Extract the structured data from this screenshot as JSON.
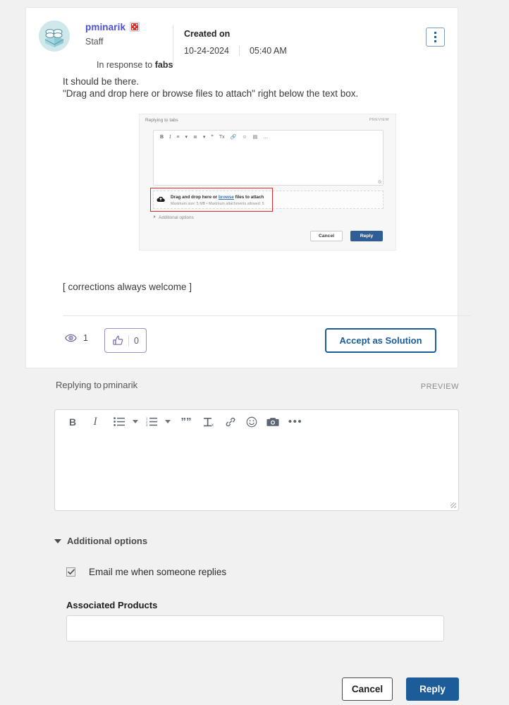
{
  "post": {
    "author": {
      "name": "pminarik",
      "role": "Staff",
      "badge_icon": "rank-badge-icon",
      "avatar_icon": "user-avatar"
    },
    "in_response_prefix": "In response to ",
    "in_response_to": "fabs",
    "meta": {
      "created_label": "Created on",
      "date": "10-24-2024",
      "time": "05:40 AM"
    },
    "menu_icon": "kebab-menu-icon",
    "body_line_1": "It should be there.",
    "body_line_2": "\"Drag and drop here or browse files to attach\" right below the text box.",
    "signature": "[ corrections always welcome ]",
    "embedded_image": {
      "title_prefix": "Replying to ",
      "title_target": "tabs",
      "preview_label": "PREVIEW",
      "toolbar": [
        "B",
        "I",
        "☰",
        "▾",
        "≡",
        "▾",
        "”",
        "Tx",
        "🔗",
        "☺",
        "📷",
        "…"
      ],
      "drop_text_before": "Drag and drop here or ",
      "drop_link": "browse",
      "drop_text_after": " files to attach",
      "drop_hint": "Maximum size: 5 MB • Maximum attachments allowed: 5",
      "additional_options": "Additional options",
      "cancel_label": "Cancel",
      "reply_label": "Reply",
      "cloud_icon": "cloud-upload-icon"
    },
    "footer": {
      "views_icon": "eye-icon",
      "views_count": "1",
      "kudos_icon": "thumbs-up-icon",
      "kudos_count": "0",
      "accept_label": "Accept as Solution"
    }
  },
  "composer": {
    "title_prefix": "Replying to",
    "title_target": "pminarik",
    "preview_label": "PREVIEW",
    "toolbar": {
      "bold": "B",
      "italic": "I",
      "bullet_list_icon": "bulleted-list-icon",
      "bullet_caret_icon": "chevron-down-icon",
      "numbered_list_icon": "numbered-list-icon",
      "numbered_caret_icon": "chevron-down-icon",
      "quote": "””",
      "clear_format_icon": "clear-formatting-icon",
      "link_icon": "link-icon",
      "emoji_icon": "emoji-icon",
      "camera_icon": "camera-icon",
      "more": "•••"
    },
    "editor_value": "",
    "editor_placeholder": "",
    "additional_options_label": "Additional options",
    "additional_options_caret_icon": "caret-down-icon",
    "email_checkbox_label": "Email me when someone replies",
    "email_checkbox_checked": true,
    "associated_products_label": "Associated Products",
    "associated_products_value": "",
    "associated_products_placeholder": "",
    "cancel_label": "Cancel",
    "reply_label": "Reply"
  },
  "colors": {
    "page_bg": "#f1f1f1",
    "card_bg": "#ffffff",
    "primary_blue": "#1c5d99",
    "author_link": "#4a4fd4",
    "kudos_purple": "#5e4f84",
    "badge_red": "#e03030",
    "highlight_red": "#e02b2b"
  }
}
